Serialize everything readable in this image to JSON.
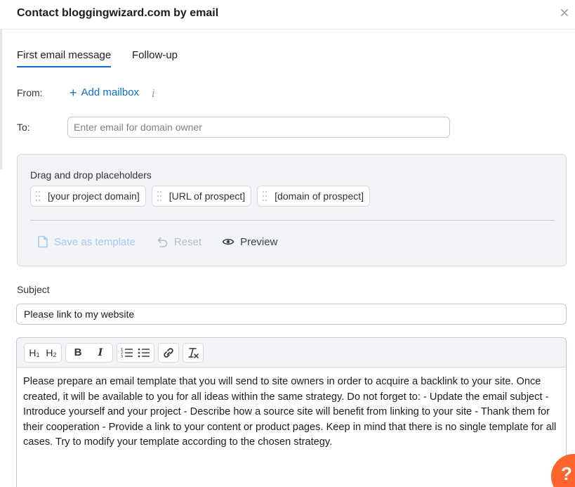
{
  "dialog": {
    "title": "Contact bloggingwizard.com by email",
    "close_icon": "close-icon"
  },
  "tabs": [
    {
      "label": "First email message",
      "active": true
    },
    {
      "label": "Follow-up",
      "active": false
    }
  ],
  "from": {
    "label": "From:",
    "add_mailbox_label": "Add mailbox",
    "add_icon": "plus-icon",
    "info_icon": "info-icon"
  },
  "to": {
    "label": "To:",
    "value": "",
    "placeholder": "Enter email for domain owner"
  },
  "placeholders": {
    "heading": "Drag and drop placeholders",
    "chips": [
      "[your project domain]",
      "[URL of prospect]",
      "[domain of prospect]"
    ],
    "actions": {
      "save_template": "Save as template",
      "reset": "Reset",
      "preview": "Preview"
    }
  },
  "subject": {
    "label": "Subject",
    "value": "Please link to my website"
  },
  "editor": {
    "toolbar": {
      "h1": "H",
      "h1_sub": "1",
      "h2": "H",
      "h2_sub": "2",
      "bold": "B",
      "italic": "I"
    },
    "body": "Please prepare an email template that you will send to site owners in order to acquire a backlink to your site. Once created, it will be available to you for all ideas within the same strategy. Do not forget to: - Update the email subject - Introduce yourself and your project - Describe how a source site will benefit from linking to your site - Thank them for their cooperation - Provide a link to your content or product pages. Keep in mind that there is no single template for all cases. Try to modify your template according to the chosen strategy."
  },
  "help": {
    "label": "?"
  },
  "colors": {
    "accent": "#0a6cd4",
    "help_button": "#ff642d",
    "panel_bg": "#f3f4f7"
  }
}
